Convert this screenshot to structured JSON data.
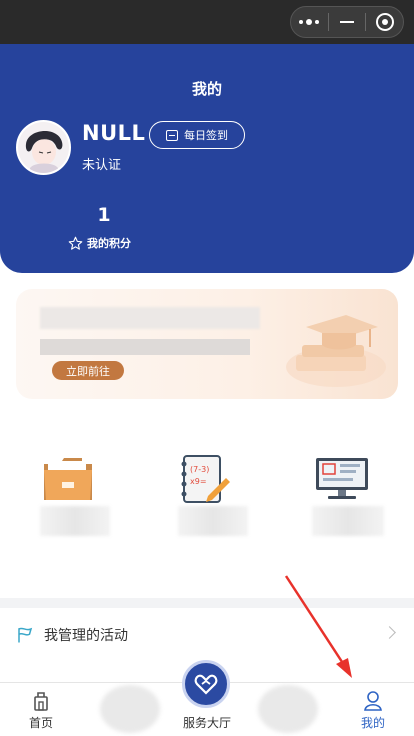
{
  "header": {
    "title": "我的",
    "username": "NULL",
    "auth_status": "未认证",
    "signin_label": "每日签到",
    "points_value": "1",
    "points_label": "我的积分"
  },
  "banner": {
    "button_label": "立即前往"
  },
  "menu": {
    "managed_activities_label": "我管理的活动"
  },
  "tabbar": {
    "home_label": "首页",
    "service_label": "服务大厅",
    "mine_label": "我的"
  },
  "colors": {
    "header_blue": "#26439c",
    "accent_orange": "#c27840",
    "active_tab": "#2f64c4",
    "annotation_arrow": "#e8322b"
  },
  "icons": [
    "more-dots-icon",
    "minimize-icon",
    "close-target-icon",
    "calendar-icon",
    "star-icon",
    "folder-icon",
    "notebook-icon",
    "monitor-icon",
    "flag-icon",
    "chevron-right-icon",
    "home-icon",
    "heart-icon",
    "person-icon"
  ]
}
